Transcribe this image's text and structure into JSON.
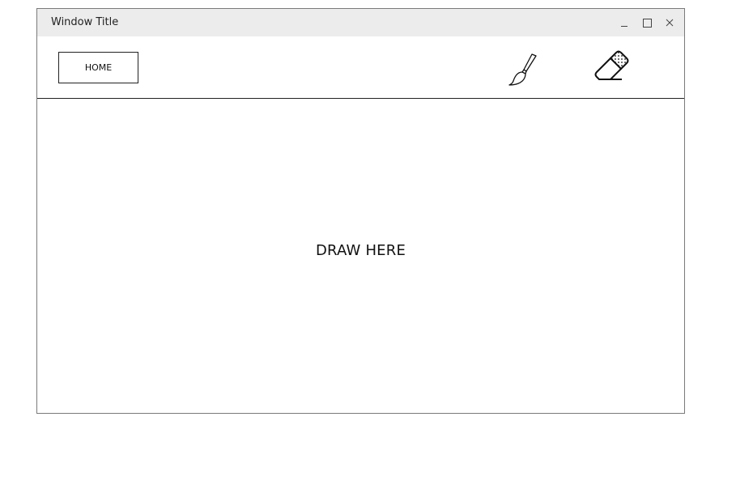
{
  "window": {
    "title": "Window Title",
    "controls": {
      "minimize_icon": "minimize-icon",
      "maximize_icon": "maximize-icon",
      "close_icon": "close-icon"
    }
  },
  "toolbar": {
    "home_label": "HOME",
    "tools": [
      {
        "name": "brush",
        "icon": "paintbrush-icon"
      },
      {
        "name": "eraser",
        "icon": "eraser-icon"
      }
    ]
  },
  "canvas": {
    "placeholder": "DRAW HERE"
  },
  "colors": {
    "titlebar_bg": "#ececec",
    "border": "#222222",
    "background": "#ffffff"
  }
}
